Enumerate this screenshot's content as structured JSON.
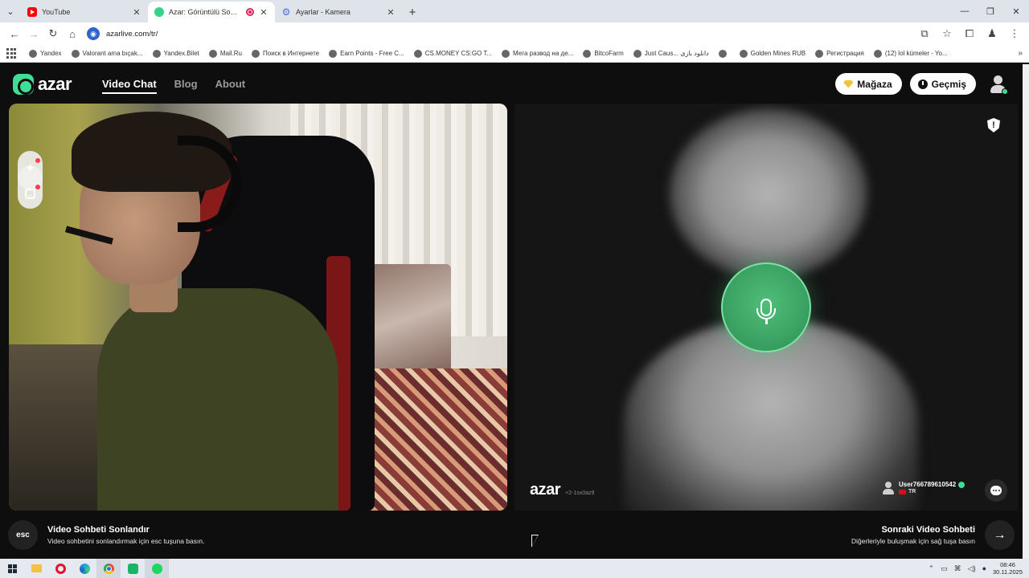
{
  "browser": {
    "tabs": [
      {
        "title": "YouTube",
        "icon": "youtube-icon",
        "active": false
      },
      {
        "title": "Azar: Görüntülü Sohbet, Ye",
        "icon": "azar-icon",
        "active": true
      },
      {
        "title": "Ayarlar - Kamera",
        "icon": "gear-icon",
        "active": false
      }
    ],
    "url": "azarlive.com/tr/",
    "bookmarks": [
      "Yandex",
      "Valorant ama bıçak...",
      "Yandex.Bilet",
      "Mail.Ru",
      "Поиск в Интернете",
      "Earn Points - Free C...",
      "CS.MONEY CS:GO T...",
      "Мега развод на де...",
      "BitcoFarm",
      "Just Caus... دانلود بازی",
      "",
      "Golden Mines RUB",
      "Регистрация",
      "(12) lol kümeler - Yo..."
    ]
  },
  "site": {
    "logo": "azar",
    "nav": [
      {
        "label": "Video Chat",
        "active": true
      },
      {
        "label": "Blog",
        "active": false
      },
      {
        "label": "About",
        "active": false
      }
    ],
    "store_label": "Mağaza",
    "history_label": "Geçmiş"
  },
  "partner": {
    "watermark_logo": "azar",
    "session_code": "+2-1sx0az9",
    "username": "User766789610542",
    "country": "TR",
    "report_glyph": "!"
  },
  "controls": {
    "esc_key": "esc",
    "end_title": "Video Sohbeti Sonlandır",
    "end_hint": "Video sohbetini sonlandırmak için esc tuşuna basın.",
    "next_title": "Sonraki Video Sohbeti",
    "next_hint": "Diğerleriyle buluşmak için sağ tuşa basın",
    "next_glyph": "→"
  },
  "taskbar": {
    "time": "08:46",
    "date": "30.11.2025"
  },
  "colors": {
    "brand_green": "#3fdd95",
    "mic_green": "#3da866",
    "page_bg": "#0e0e0e"
  }
}
